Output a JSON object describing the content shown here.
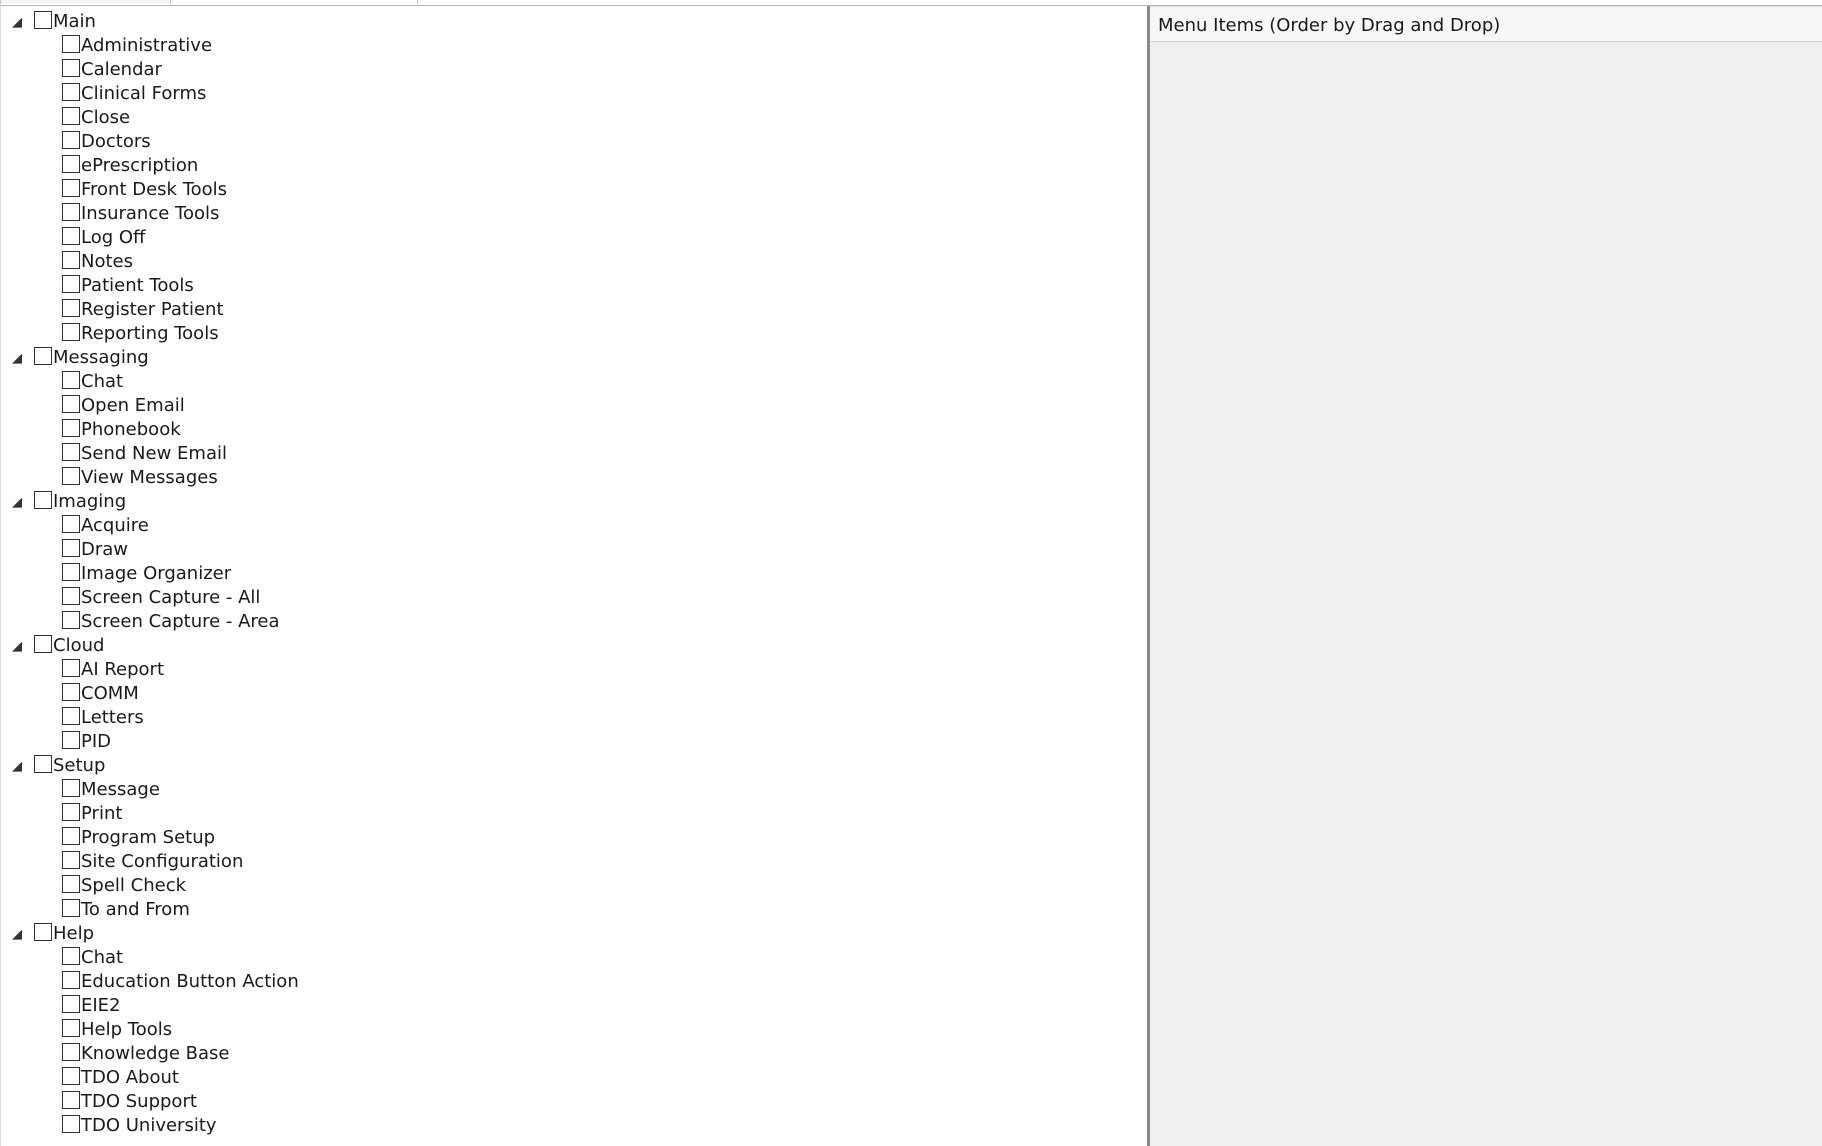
{
  "window": {
    "right_panel_header": "Menu Items (Order by Drag and Drop)"
  },
  "tree": [
    {
      "label": "Main",
      "expander_icon": "triangle-down",
      "checked": false,
      "children": [
        "Administrative",
        "Calendar",
        "Clinical Forms",
        "Close",
        "Doctors",
        "ePrescription",
        "Front Desk Tools",
        "Insurance Tools",
        "Log Off",
        "Notes",
        "Patient Tools",
        "Register Patient",
        "Reporting Tools"
      ]
    },
    {
      "label": "Messaging",
      "expander_icon": "triangle-down",
      "checked": false,
      "children": [
        "Chat",
        "Open Email",
        "Phonebook",
        "Send New Email",
        "View Messages"
      ]
    },
    {
      "label": "Imaging",
      "expander_icon": "triangle-down",
      "checked": false,
      "children": [
        "Acquire",
        "Draw",
        "Image Organizer",
        "Screen Capture - All",
        "Screen Capture - Area"
      ]
    },
    {
      "label": "Cloud",
      "expander_icon": "triangle-down",
      "checked": false,
      "children": [
        "AI Report",
        "COMM",
        "Letters",
        "PID"
      ]
    },
    {
      "label": "Setup",
      "expander_icon": "triangle-down",
      "checked": false,
      "children": [
        "Message",
        "Print",
        "Program Setup",
        "Site Configuration",
        "Spell Check",
        "To and From"
      ]
    },
    {
      "label": "Help",
      "expander_icon": "triangle-down",
      "checked": false,
      "children": [
        "Chat",
        "Education Button Action",
        "EIE2",
        "Help Tools",
        "Knowledge Base",
        "TDO About",
        "TDO Support",
        "TDO University"
      ]
    }
  ],
  "colors": {
    "right_panel_background": "#f0f0f0",
    "splitter": "#8a8a8a",
    "checkbox_border": "#333333"
  }
}
